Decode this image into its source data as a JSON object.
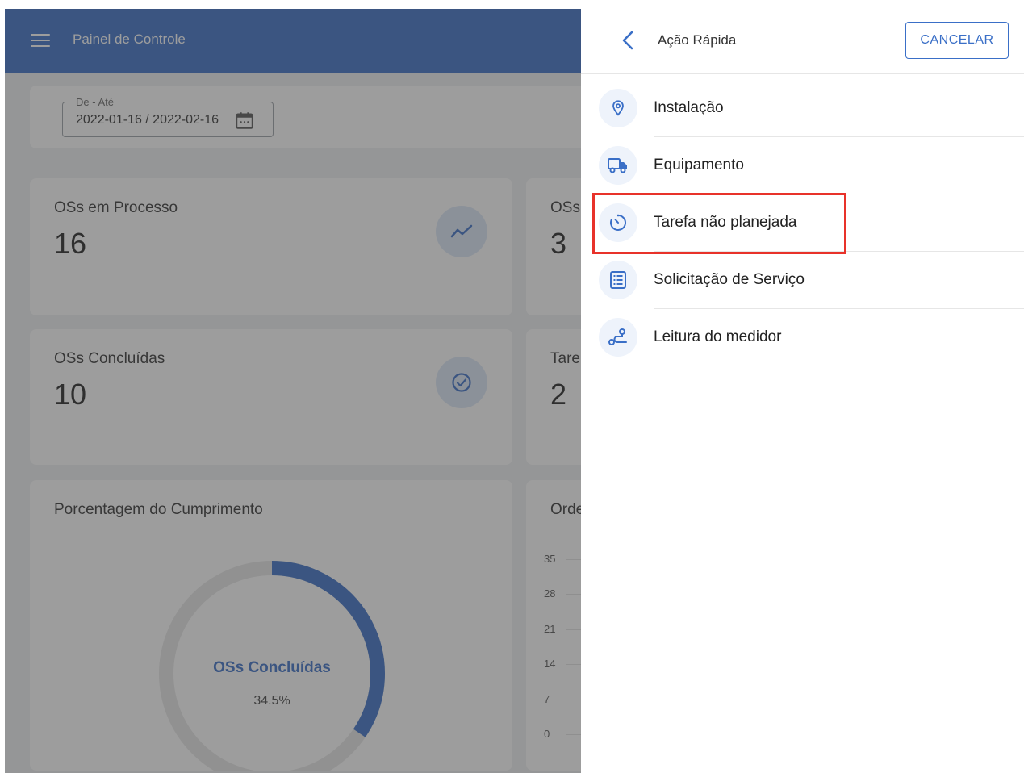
{
  "dashboard": {
    "appbar_title": "Painel de Controle",
    "date_filter": {
      "legend": "De - Até",
      "value": "2022-01-16 / 2022-02-16"
    },
    "cards": {
      "in_process": {
        "title": "OSs em Processo",
        "value": "16"
      },
      "completed": {
        "title": "OSs Concluídas",
        "value": "10"
      },
      "right_top": {
        "title": "OSs",
        "value": "3"
      },
      "right_mid": {
        "title": "Tare",
        "value": "2"
      },
      "compliance": {
        "title": "Porcentagem do Cumprimento",
        "donut_label": "OSs Concluídas",
        "donut_value": "34.5%",
        "donut_fraction": 0.345
      },
      "orders": {
        "title": "Orde",
        "y_ticks": [
          "35",
          "28",
          "21",
          "14",
          "7",
          "0"
        ]
      }
    }
  },
  "quick_action": {
    "title": "Ação Rápida",
    "cancel_label": "CANCELAR",
    "items": [
      {
        "label": "Instalação",
        "icon": "location-pin-icon"
      },
      {
        "label": "Equipamento",
        "icon": "truck-icon"
      },
      {
        "label": "Tarefa não planejada",
        "icon": "timer-icon"
      },
      {
        "label": "Solicitação de Serviço",
        "icon": "form-list-icon"
      },
      {
        "label": "Leitura do medidor",
        "icon": "route-icon"
      }
    ]
  },
  "colors": {
    "primary": "#3a6fc7",
    "highlight": "#e8322a",
    "icon_bg": "#eef3fb"
  }
}
